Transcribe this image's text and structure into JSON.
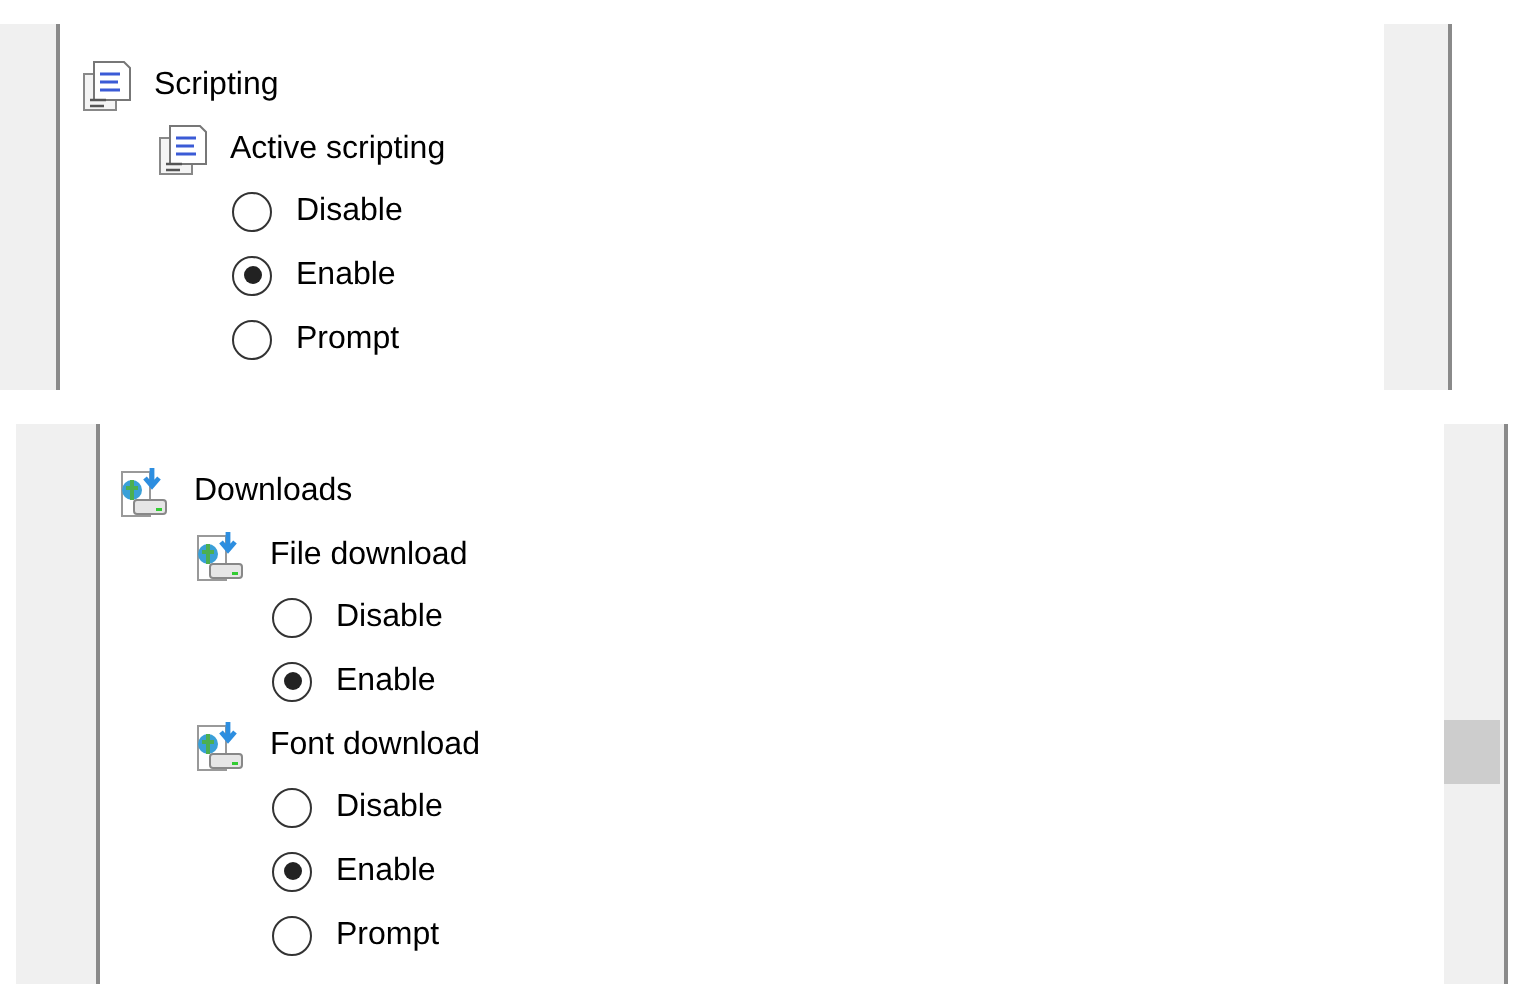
{
  "panels": [
    {
      "kind": "plain",
      "sections": [
        {
          "label": "Scripting",
          "kind": "script",
          "children": [
            {
              "label": "Active scripting",
              "kind": "script",
              "options": [
                {
                  "label": "Disable",
                  "selected": false
                },
                {
                  "label": "Enable",
                  "selected": true
                },
                {
                  "label": "Prompt",
                  "selected": false
                }
              ]
            }
          ]
        }
      ]
    },
    {
      "kind": "scrollbar",
      "sections": [
        {
          "label": "Downloads",
          "kind": "download",
          "children": [
            {
              "label": "File download",
              "kind": "download",
              "options": [
                {
                  "label": "Disable",
                  "selected": false
                },
                {
                  "label": "Enable",
                  "selected": true
                }
              ]
            },
            {
              "label": "Font download",
              "kind": "download",
              "options": [
                {
                  "label": "Disable",
                  "selected": false
                },
                {
                  "label": "Enable",
                  "selected": true
                },
                {
                  "label": "Prompt",
                  "selected": false
                }
              ]
            }
          ]
        }
      ]
    }
  ]
}
